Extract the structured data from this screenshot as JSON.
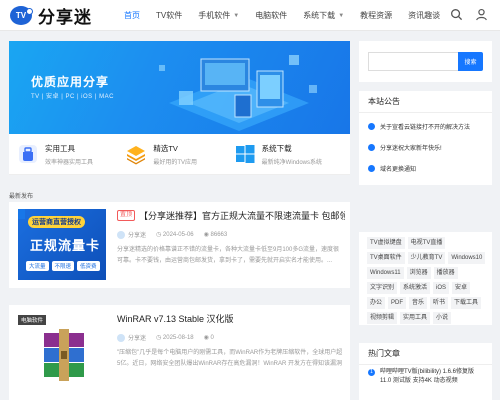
{
  "header": {
    "logo_badge": "TV",
    "logo_text": "分享迷",
    "nav": [
      {
        "label": "首页",
        "active": true,
        "dropdown": false
      },
      {
        "label": "TV软件",
        "active": false,
        "dropdown": false
      },
      {
        "label": "手机软件",
        "active": false,
        "dropdown": true
      },
      {
        "label": "电脑软件",
        "active": false,
        "dropdown": false
      },
      {
        "label": "系统下载",
        "active": false,
        "dropdown": true
      },
      {
        "label": "教程资源",
        "active": false,
        "dropdown": false
      },
      {
        "label": "资讯趣谈",
        "active": false,
        "dropdown": false
      }
    ],
    "icons": [
      "search-icon",
      "user-icon"
    ]
  },
  "hero": {
    "title": "优质应用分享",
    "subtitle": "TV | 安卓 | PC | iOS | MAC"
  },
  "categories": [
    {
      "title": "实用工具",
      "desc": "效率神器实用工具",
      "icon": "tool-icon"
    },
    {
      "title": "精选TV",
      "desc": "最好用的TV应用",
      "icon": "layers-icon"
    },
    {
      "title": "系统下载",
      "desc": "最新纯净Windows系统",
      "icon": "windows-icon"
    }
  ],
  "section_label": "最新发布",
  "posts": [
    {
      "tag": "置顶",
      "title": "【分享迷推荐】官方正规大流量不限速流量卡 包邮领取",
      "author": "分享迷",
      "date": "2024-05-06",
      "views": "86663",
      "excerpt": "分享迷精选的价格靠谱正不错的流量卡，各种大流量卡低至9月100多G流量，速度很可靠。卡不要钱，由运营商包邮发货，拿到卡了，需要先就开启实名才能使用。..."
    },
    {
      "category": "电脑软件",
      "title": "WinRAR v7.13 Stable 汉化版",
      "author": "分享迷",
      "date": "2025-08-18",
      "views": "0",
      "excerpt": "\"压缩包\"几乎是每个电脑用户的刚需工具，而WinRAR作为老牌压缩软件，全球用户超5亿。近日，网络安全团队爆出WinRAR存在高危漏洞！WinRAR 开发方在得知该漏洞后，已于 2025 年 7月..."
    }
  ],
  "post1_thumb": {
    "badge": "运营商直营授权",
    "big": "正规流量卡",
    "chips": [
      "大流量",
      "不限速",
      "低资费"
    ]
  },
  "sidebar": {
    "search_placeholder": "",
    "search_button": "搜索",
    "notice_title": "本站公告",
    "notices": [
      "关于宣看云链接打不开的解决方法",
      "分享迷祝大家新年快乐!",
      "域名更换通知"
    ],
    "tags": [
      "TV虚拟键盘",
      "电视TV直播",
      "TV桌面软件",
      "少儿教育TV",
      "Windows10",
      "Windows11",
      "浏览器",
      "播放器",
      "文字识别",
      "系统激活",
      "iOS",
      "安卓",
      "办公",
      "PDF",
      "音乐",
      "听书",
      "下载工具",
      "视频剪辑",
      "实用工具",
      "小说"
    ],
    "hot_title": "热门文章",
    "hot": [
      {
        "num": "1",
        "text": "哔哩哔哩TV版(bilibility) 1.6.6修复版11.0 测试版 支持4K 动态视频"
      }
    ]
  },
  "colors": {
    "accent": "#1677ff",
    "hot_tag": "#f25a5a"
  }
}
